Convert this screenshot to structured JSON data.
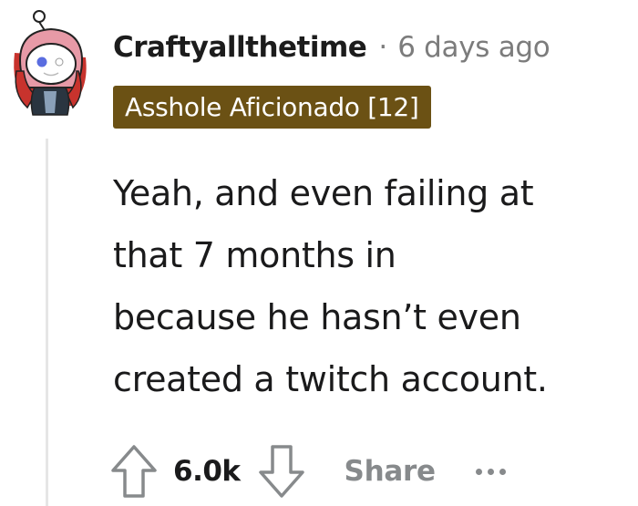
{
  "comment": {
    "author": "Craftyallthetime",
    "separator": "·",
    "timestamp": "6 days ago",
    "flair": "Asshole Aficionado [12]",
    "flair_color": "#6b5114",
    "body_lines": [
      "Yeah, and even failing at",
      "that 7 months in",
      "because he hasn’t even",
      "created a twitch account."
    ],
    "avatar_icon": "snoo-avatar-red-hood",
    "actions": {
      "upvote_icon": "arrow-up-icon",
      "vote_count": "6.0k",
      "downvote_icon": "arrow-down-icon",
      "share_label": "Share",
      "more_icon": "ellipsis-icon"
    }
  }
}
